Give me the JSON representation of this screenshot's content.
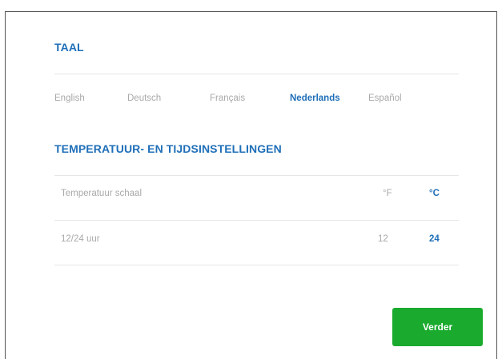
{
  "language_section": {
    "title": "TAAL",
    "languages": [
      {
        "label": "English",
        "selected": false
      },
      {
        "label": "Deutsch",
        "selected": false
      },
      {
        "label": "Français",
        "selected": false
      },
      {
        "label": "Nederlands",
        "selected": true
      },
      {
        "label": "Español",
        "selected": false
      }
    ]
  },
  "settings_section": {
    "title": "TEMPERATUUR- EN TIJDSINSTELLINGEN",
    "temperature": {
      "label": "Temperatuur schaal",
      "option_f": "°F",
      "option_c": "°C",
      "selected": "°C"
    },
    "time_format": {
      "label": "12/24 uur",
      "option_12": "12",
      "option_24": "24",
      "selected": "24"
    }
  },
  "actions": {
    "next_label": "Verder"
  },
  "colors": {
    "accent": "#1f6fb8",
    "button": "#1aaa2e",
    "muted_text": "#a9a9a9"
  }
}
